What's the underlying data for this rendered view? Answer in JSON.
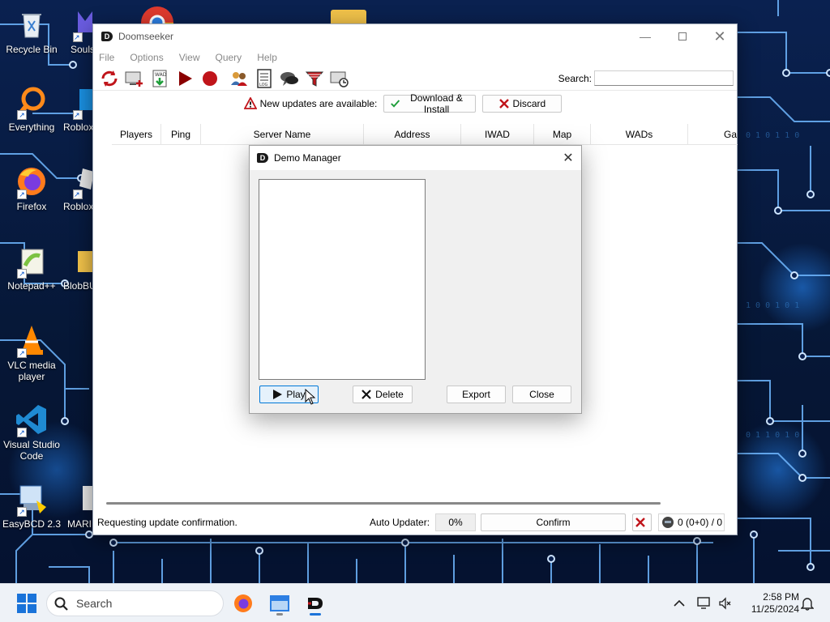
{
  "desktop": {
    "icons": [
      {
        "label": "Recycle Bin"
      },
      {
        "label": "Souls"
      },
      {
        "label": "Everything"
      },
      {
        "label": "Roblox"
      },
      {
        "label": "Firefox"
      },
      {
        "label": "Roblox"
      },
      {
        "label": "Notepad++"
      },
      {
        "label": "BlobBU"
      },
      {
        "label": "VLC media player"
      },
      {
        "label": "Visual Studio Code"
      },
      {
        "label": "EasyBCD 2.3"
      },
      {
        "label": "MARI"
      }
    ]
  },
  "window": {
    "title": "Doomseeker",
    "menu": [
      "File",
      "Options",
      "View",
      "Query",
      "Help"
    ],
    "search_label": "Search:",
    "search_value": "",
    "update_message": "New updates are available:",
    "download_label": "Download & Install",
    "discard_label": "Discard",
    "columns": [
      "Players",
      "Ping",
      "Server Name",
      "Address",
      "IWAD",
      "Map",
      "WADs",
      "Ga"
    ],
    "status_text": "Requesting update confirmation.",
    "auto_updater_label": "Auto Updater:",
    "progress_percent": "0%",
    "confirm_label": "Confirm",
    "players_count": "0 (0+0) / 0"
  },
  "dialog": {
    "title": "Demo Manager",
    "play_label": "Play",
    "delete_label": "Delete",
    "export_label": "Export",
    "close_label": "Close"
  },
  "taskbar": {
    "search_placeholder": "Search",
    "time": "2:58 PM",
    "date": "11/25/2024"
  },
  "colors": {
    "accent": "#0078d7",
    "play_red": "#cc0000",
    "check_green": "#1e9e3a"
  }
}
